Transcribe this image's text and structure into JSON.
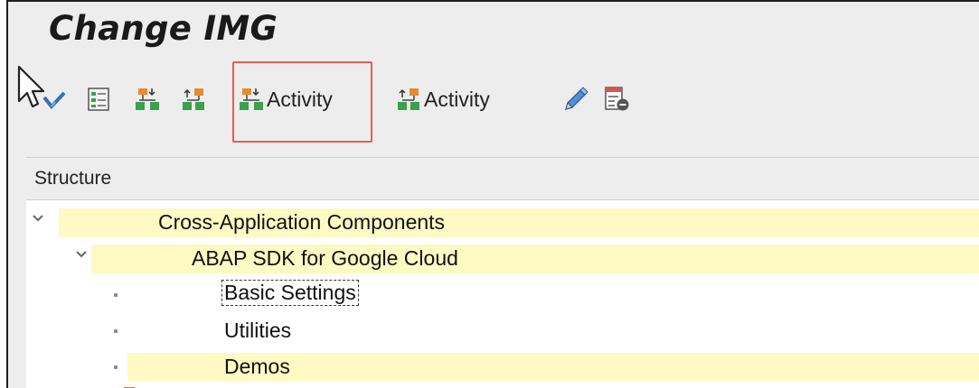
{
  "window": {
    "title": "Change IMG"
  },
  "toolbar": {
    "buttons": [
      {
        "name": "select-all",
        "icon": "checkbox-select-icon",
        "label": ""
      },
      {
        "name": "expand-subtree",
        "icon": "expand-tree-icon",
        "label": ""
      },
      {
        "name": "collapse-subtree",
        "icon": "collapse-tree-icon",
        "label": ""
      },
      {
        "name": "expand-activity",
        "icon": "expand-tree-icon",
        "label": "Activity"
      },
      {
        "name": "collapse-activity",
        "icon": "collapse-tree-icon",
        "label": "Activity"
      },
      {
        "name": "edit",
        "icon": "pencil-icon",
        "label": ""
      },
      {
        "name": "list-delete",
        "icon": "list-delete-icon",
        "label": ""
      }
    ],
    "highlight_color": "#ef5a52"
  },
  "tree": {
    "header": "Structure",
    "rows": [
      {
        "text": "Cross-Application Components",
        "level": 0,
        "expanded": true,
        "highlighted": true
      },
      {
        "text": "ABAP SDK for Google Cloud",
        "level": 1,
        "expanded": true,
        "highlighted": true
      },
      {
        "text": "Basic Settings",
        "level": 2,
        "focused": true,
        "highlighted": false
      },
      {
        "text": "Utilities",
        "level": 2,
        "highlighted": false
      },
      {
        "text": "Demos",
        "level": 2,
        "highlighted": true
      }
    ],
    "highlight_color": "#fff9c4"
  }
}
